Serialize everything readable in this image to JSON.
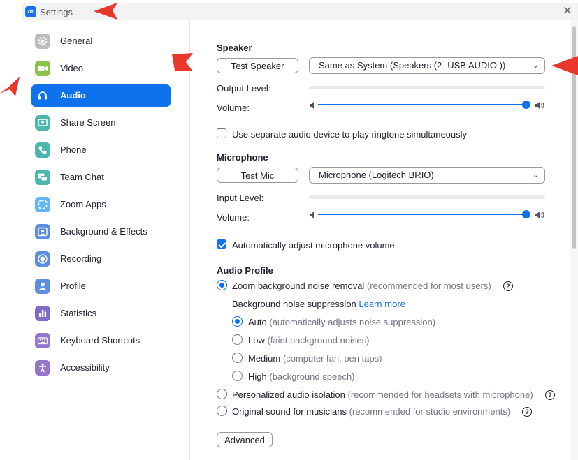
{
  "window": {
    "title": "Settings",
    "logo_text": "zm"
  },
  "sidebar": {
    "items": [
      {
        "label": "General",
        "icon": "gear-icon",
        "color": "#bdbdbd"
      },
      {
        "label": "Video",
        "icon": "video-icon",
        "color": "#8bc34a"
      },
      {
        "label": "Audio",
        "icon": "headphones-icon",
        "color": "#0e72ed",
        "active": true
      },
      {
        "label": "Share Screen",
        "icon": "share-screen-icon",
        "color": "#4db6ac"
      },
      {
        "label": "Phone",
        "icon": "phone-icon",
        "color": "#4db6ac"
      },
      {
        "label": "Team Chat",
        "icon": "chat-icon",
        "color": "#4db6ac"
      },
      {
        "label": "Zoom Apps",
        "icon": "apps-icon",
        "color": "#64b5f6"
      },
      {
        "label": "Background & Effects",
        "icon": "background-icon",
        "color": "#5c8de0"
      },
      {
        "label": "Recording",
        "icon": "record-icon",
        "color": "#5c8de0"
      },
      {
        "label": "Profile",
        "icon": "profile-icon",
        "color": "#5c8de0"
      },
      {
        "label": "Statistics",
        "icon": "statistics-icon",
        "color": "#7e6cc9"
      },
      {
        "label": "Keyboard Shortcuts",
        "icon": "keyboard-icon",
        "color": "#9575cd"
      },
      {
        "label": "Accessibility",
        "icon": "accessibility-icon",
        "color": "#9575cd"
      }
    ]
  },
  "speaker": {
    "heading": "Speaker",
    "test_label": "Test Speaker",
    "device": "Same as System (Speakers (2- USB  AUDIO  ))",
    "output_label": "Output Level:",
    "volume_label": "Volume:",
    "volume_level": 1.0,
    "separate_ringtone": "Use separate audio device to play ringtone simultaneously"
  },
  "microphone": {
    "heading": "Microphone",
    "test_label": "Test Mic",
    "device": "Microphone (Logitech BRIO)",
    "input_label": "Input Level:",
    "volume_label": "Volume:",
    "volume_level": 1.0,
    "auto_adjust": "Automatically adjust microphone volume"
  },
  "audio_profile": {
    "heading": "Audio Profile",
    "zoom_noise": "Zoom background noise removal",
    "zoom_noise_note": "(recommended for most users)",
    "suppression_label": "Background noise suppression",
    "learn_more": "Learn more",
    "levels": [
      {
        "label": "Auto",
        "note": "(automatically adjusts noise suppression)"
      },
      {
        "label": "Low",
        "note": "(faint background noises)"
      },
      {
        "label": "Medium",
        "note": "(computer fan, pen taps)"
      },
      {
        "label": "High",
        "note": "(background speech)"
      }
    ],
    "personalized": "Personalized audio isolation",
    "personalized_note": "(recommended for headsets with microphone)",
    "original": "Original sound for musicians",
    "original_note": "(recommended for studio environments)",
    "help_glyph": "?"
  },
  "advanced_label": "Advanced",
  "icons": {
    "chevron": "⌄",
    "close": "✕"
  },
  "colors": {
    "accent": "#0e72ed",
    "annotation_arrow": "#e8382c"
  }
}
